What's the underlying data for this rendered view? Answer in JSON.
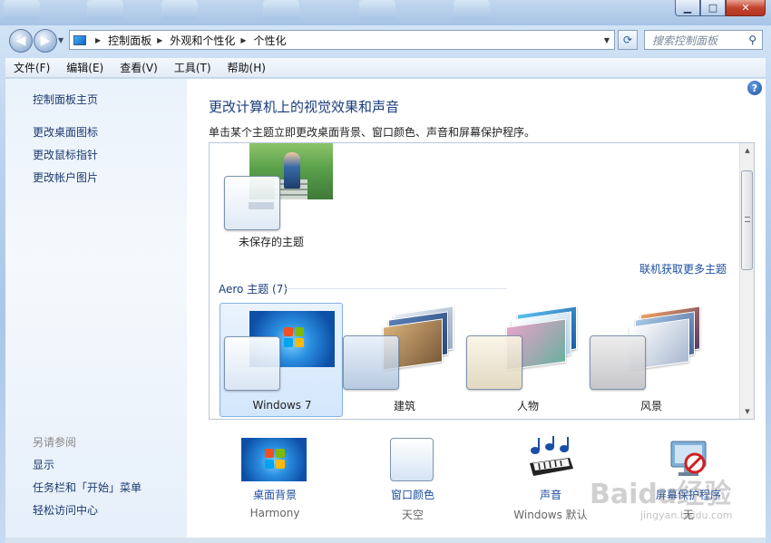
{
  "window": {
    "controls": {
      "minimize": "▁",
      "maximize": "□",
      "close": "✕"
    }
  },
  "nav": {
    "back_icon": "◀",
    "forward_icon": "▶",
    "breadcrumbs": [
      "控制面板",
      "外观和个性化",
      "个性化"
    ],
    "search_placeholder": "搜索控制面板"
  },
  "menu": [
    "文件(F)",
    "编辑(E)",
    "查看(V)",
    "工具(T)",
    "帮助(H)"
  ],
  "left_pane": {
    "links": [
      "控制面板主页",
      "更改桌面图标",
      "更改鼠标指针",
      "更改帐户图片"
    ],
    "see_also_title": "另请参阅",
    "see_also": [
      "显示",
      "任务栏和「开始」菜单",
      "轻松访问中心"
    ]
  },
  "main": {
    "heading": "更改计算机上的视觉效果和声音",
    "subtext": "单击某个主题立即更改桌面背景、窗口颜色、声音和屏幕保护程序。",
    "unsaved_label": "未保存的主题",
    "get_more": "联机获取更多主题",
    "group_title": "Aero 主题 (7)",
    "themes": [
      {
        "label": "Windows 7",
        "selected": true
      },
      {
        "label": "建筑",
        "selected": false
      },
      {
        "label": "人物",
        "selected": false
      },
      {
        "label": "风景",
        "selected": false
      }
    ]
  },
  "bottom": [
    {
      "label": "桌面背景",
      "sub": "Harmony"
    },
    {
      "label": "窗口颜色",
      "sub": "天空"
    },
    {
      "label": "声音",
      "sub": "Windows 默认"
    },
    {
      "label": "屏幕保护程序",
      "sub": "无"
    }
  ],
  "watermark": {
    "brand": "Baidu经验",
    "url": "jingyan.baidu.com"
  },
  "colors": {
    "link": "#1c4ea1",
    "heading": "#1a3d7c",
    "selected_bg": "#d3e6fb"
  }
}
